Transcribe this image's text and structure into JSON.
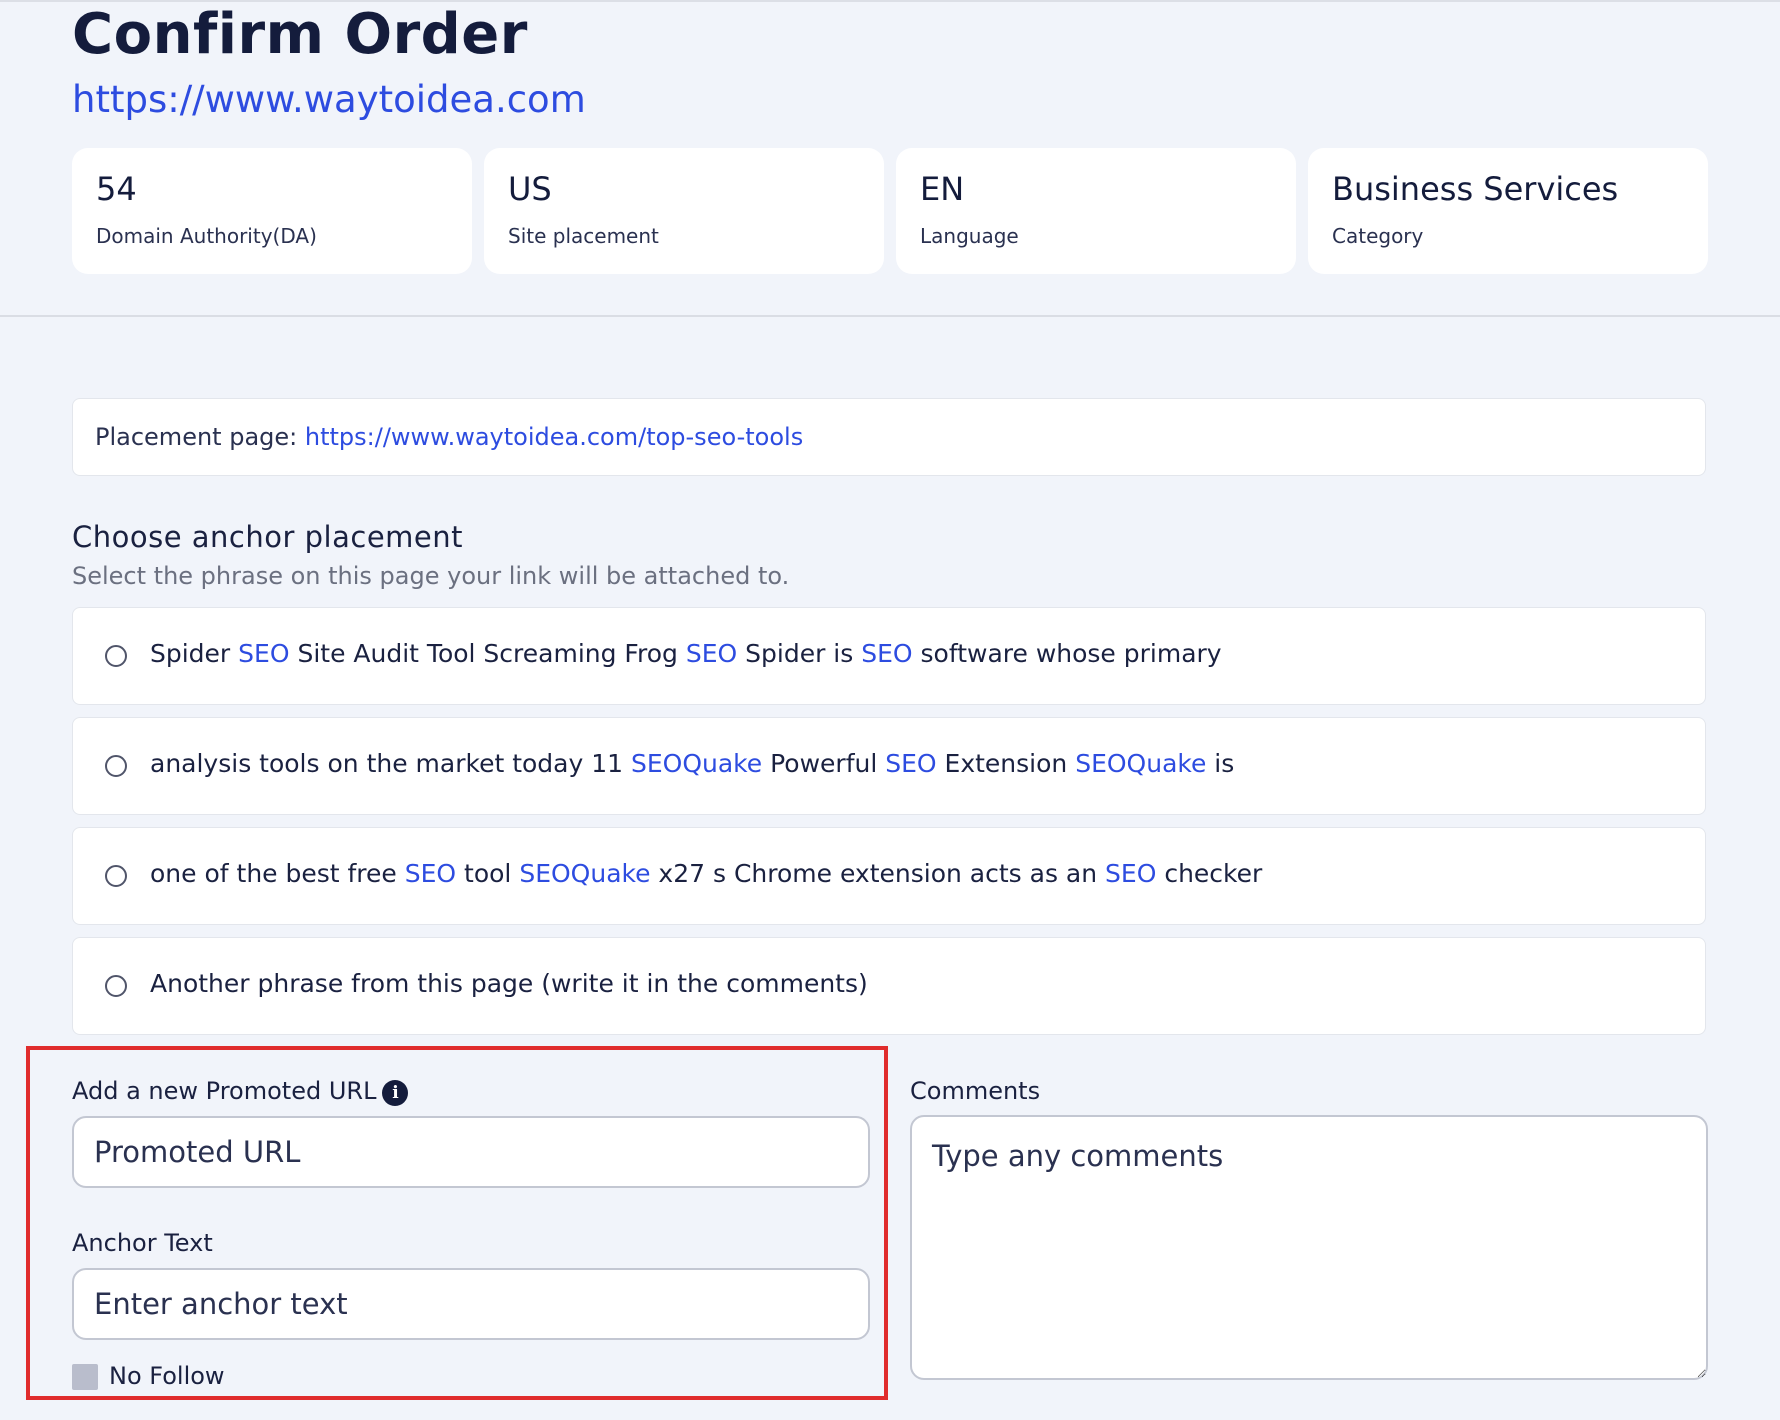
{
  "header": {
    "title": "Confirm Order",
    "site_url": "https://www.waytoidea.com"
  },
  "stats": [
    {
      "value": "54",
      "label": "Domain Authority(DA)"
    },
    {
      "value": "US",
      "label": "Site placement"
    },
    {
      "value": "EN",
      "label": "Language"
    },
    {
      "value": "Business Services",
      "label": "Category"
    }
  ],
  "placement": {
    "label": "Placement page:",
    "url": "https://www.waytoidea.com/top-seo-tools"
  },
  "anchor_section": {
    "title": "Choose anchor placement",
    "subtitle": "Select the phrase on this page your link will be attached to."
  },
  "options": [
    [
      {
        "t": "Spider ",
        "kw": false
      },
      {
        "t": "SEO",
        "kw": true
      },
      {
        "t": " Site Audit Tool Screaming Frog ",
        "kw": false
      },
      {
        "t": "SEO",
        "kw": true
      },
      {
        "t": " Spider is ",
        "kw": false
      },
      {
        "t": "SEO",
        "kw": true
      },
      {
        "t": " software whose primary",
        "kw": false
      }
    ],
    [
      {
        "t": "analysis tools on the market today 11 ",
        "kw": false
      },
      {
        "t": "SEOQuake",
        "kw": true
      },
      {
        "t": " Powerful ",
        "kw": false
      },
      {
        "t": "SEO",
        "kw": true
      },
      {
        "t": " Extension ",
        "kw": false
      },
      {
        "t": "SEOQuake",
        "kw": true
      },
      {
        "t": " is",
        "kw": false
      }
    ],
    [
      {
        "t": "one of the best free ",
        "kw": false
      },
      {
        "t": "SEO",
        "kw": true
      },
      {
        "t": " tool ",
        "kw": false
      },
      {
        "t": "SEOQuake",
        "kw": true
      },
      {
        "t": " x27 s Chrome extension acts as an ",
        "kw": false
      },
      {
        "t": "SEO",
        "kw": true
      },
      {
        "t": " checker",
        "kw": false
      }
    ],
    [
      {
        "t": "Another phrase from this page (write it in the comments)",
        "kw": false
      }
    ]
  ],
  "form": {
    "promoted_url_label": "Add a new Promoted URL",
    "promoted_url_placeholder": "Promoted URL",
    "anchor_label": "Anchor Text",
    "anchor_placeholder": "Enter anchor text",
    "nofollow_label": "No Follow",
    "comments_label": "Comments",
    "comments_placeholder": "Type any comments"
  },
  "icons": {
    "info": "info-icon"
  },
  "colors": {
    "accent": "#2d4ce0",
    "highlight_border": "#e02c2c",
    "background": "#f1f4fa"
  }
}
